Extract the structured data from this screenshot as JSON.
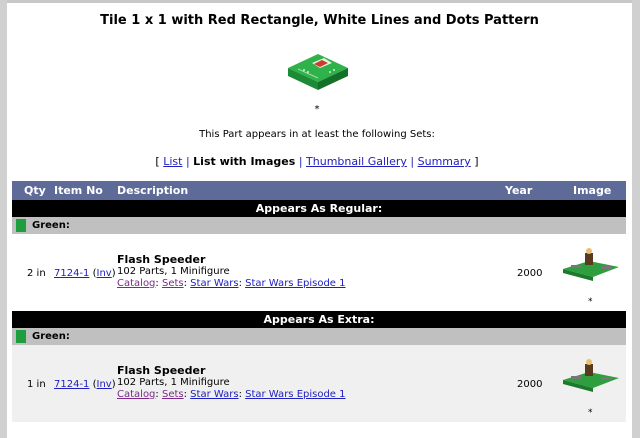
{
  "title": "Tile 1 x 1 with Red Rectangle, White Lines and Dots Pattern",
  "star": "*",
  "appears_text": "This Part appears in at least the following Sets:",
  "view_nav": {
    "open": "[",
    "list": "List",
    "sep": "|",
    "list_with_images": "List with Images",
    "thumbnail_gallery": "Thumbnail Gallery",
    "summary": "Summary",
    "close": "]"
  },
  "table": {
    "headers": {
      "qty": "Qty",
      "item_no": "Item No",
      "description": "Description",
      "year": "Year",
      "image": "Image"
    },
    "sections": [
      {
        "label": "Appears As Regular:",
        "color": "Green:",
        "item": {
          "qty": "2 in",
          "item_no": "7124-1",
          "inv": "Inv",
          "name": "Flash Speeder",
          "details": "102 Parts, 1 Minifigure",
          "crumbs": [
            "Catalog",
            "Sets",
            "Star Wars",
            "Star Wars Episode 1"
          ],
          "year": "2000",
          "star": "*"
        }
      },
      {
        "label": "Appears As Extra:",
        "color": "Green:",
        "item": {
          "qty": "1 in",
          "item_no": "7124-1",
          "inv": "Inv",
          "name": "Flash Speeder",
          "details": "102 Parts, 1 Minifigure",
          "crumbs": [
            "Catalog",
            "Sets",
            "Star Wars",
            "Star Wars Episode 1"
          ],
          "year": "2000",
          "star": "*"
        }
      }
    ]
  },
  "colors": {
    "header_bg": "#5e6b99",
    "swatch_green": "#1f9e3e",
    "link": "#2020c0"
  }
}
